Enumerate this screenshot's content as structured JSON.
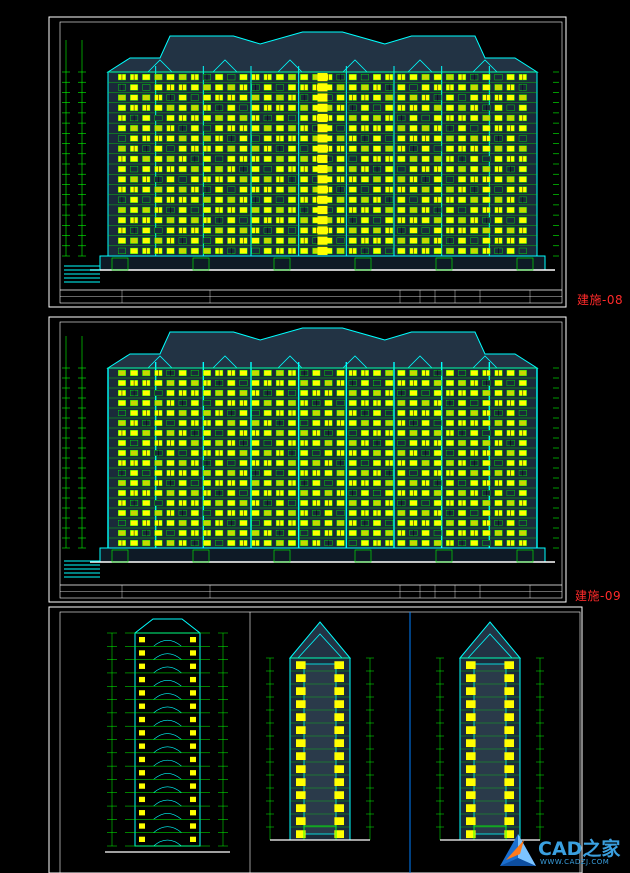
{
  "sheets": {
    "sheet1": {
      "label": "建施-08"
    },
    "sheet2": {
      "label": "建施-09"
    }
  },
  "watermark": {
    "brand": "CAD之家",
    "url": "WWW.CADZJ.COM"
  },
  "colors": {
    "background": "#000000",
    "frame": "#ffffff",
    "outline": "#00ffff",
    "window": "#ffff00",
    "detail": "#00ff00",
    "label": "#ff2a2a",
    "watermark": "#3aa0e0"
  },
  "drawing": {
    "floors_main": 18,
    "window_columns_main": 34,
    "floors_section": 16,
    "floors_side": 14
  }
}
